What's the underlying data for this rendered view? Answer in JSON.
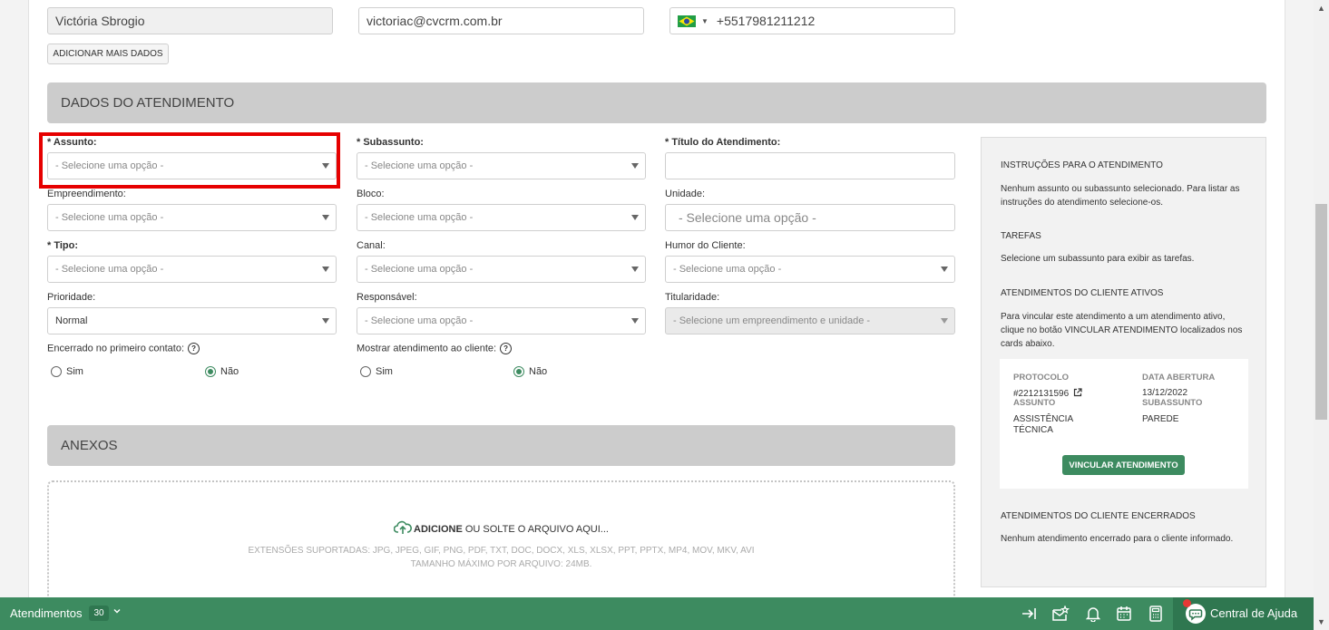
{
  "contact": {
    "name": "Victória Sbrogio",
    "email": "victoriac@cvcrm.com.br",
    "phone": "+5517981211212",
    "add_more_label": "ADICIONAR MAIS DADOS"
  },
  "sections": {
    "atendimento_title": "DADOS DO ATENDIMENTO",
    "anexos_title": "ANEXOS"
  },
  "form": {
    "assunto": {
      "label": "* Assunto:",
      "value": "- Selecione uma opção -"
    },
    "subassunto": {
      "label": "* Subassunto:",
      "value": "- Selecione uma opção -"
    },
    "titulo": {
      "label": "* Título do Atendimento:",
      "value": ""
    },
    "empreendimento": {
      "label": "Empreendimento:",
      "value": "- Selecione uma opção -"
    },
    "bloco": {
      "label": "Bloco:",
      "value": "- Selecione uma opção -"
    },
    "unidade": {
      "label": "Unidade:",
      "value": "- Selecione uma opção -"
    },
    "tipo": {
      "label": "* Tipo:",
      "value": "- Selecione uma opção -"
    },
    "canal": {
      "label": "Canal:",
      "value": "- Selecione uma opção -"
    },
    "humor": {
      "label": "Humor do Cliente:",
      "value": "- Selecione uma opção -"
    },
    "prioridade": {
      "label": "Prioridade:",
      "value": "Normal"
    },
    "responsavel": {
      "label": "Responsável:",
      "value": "- Selecione uma opção -"
    },
    "titularidade": {
      "label": "Titularidade:",
      "value": "- Selecione um empreendimento e unidade -"
    },
    "encerrado": {
      "label": "Encerrado no primeiro contato:",
      "sim": "Sim",
      "nao": "Não",
      "selected": "nao"
    },
    "mostrar": {
      "label": "Mostrar atendimento ao cliente:",
      "sim": "Sim",
      "nao": "Não",
      "selected": "nao"
    }
  },
  "anexos": {
    "add": "ADICIONE",
    "drop": " OU SOLTE O ARQUIVO AQUI...",
    "extensions": "EXTENSÕES SUPORTADAS: JPG, JPEG, GIF, PNG, PDF, TXT, DOC, DOCX, XLS, XLSX, PPT, PPTX, MP4, MOV, MKV, AVI",
    "max_size": "TAMANHO MÁXIMO POR ARQUIVO: 24MB."
  },
  "panel": {
    "instr_title": "INSTRUÇÕES PARA O ATENDIMENTO",
    "instr_text": "Nenhum assunto ou subassunto selecionado. Para listar as instruções do atendimento selecione-os.",
    "tarefas_title": "TAREFAS",
    "tarefas_text": "Selecione um subassunto para exibir as tarefas.",
    "ativos_title": "ATENDIMENTOS DO CLIENTE ATIVOS",
    "ativos_text": "Para vincular este atendimento a um atendimento ativo, clique no botão VINCULAR ATENDIMENTO localizados nos cards abaixo.",
    "card": {
      "protocolo_label": "PROTOCOLO",
      "protocolo_value": "#2212131596",
      "data_label": "DATA ABERTURA",
      "data_value": "13/12/2022",
      "assunto_label": "ASSUNTO",
      "assunto_value": "ASSISTÊNCIA TÉCNICA",
      "subassunto_label": "SUBASSUNTO",
      "subassunto_value": "PAREDE",
      "button": "VINCULAR ATENDIMENTO"
    },
    "encerrados_title": "ATENDIMENTOS DO CLIENTE ENCERRADOS",
    "encerrados_text": "Nenhum atendimento encerrado para o cliente informado."
  },
  "bottombar": {
    "atendimentos": "Atendimentos",
    "count": "30",
    "help": "Central de Ajuda"
  },
  "colors": {
    "accent": "#3d8b60",
    "highlight": "#e60000"
  }
}
